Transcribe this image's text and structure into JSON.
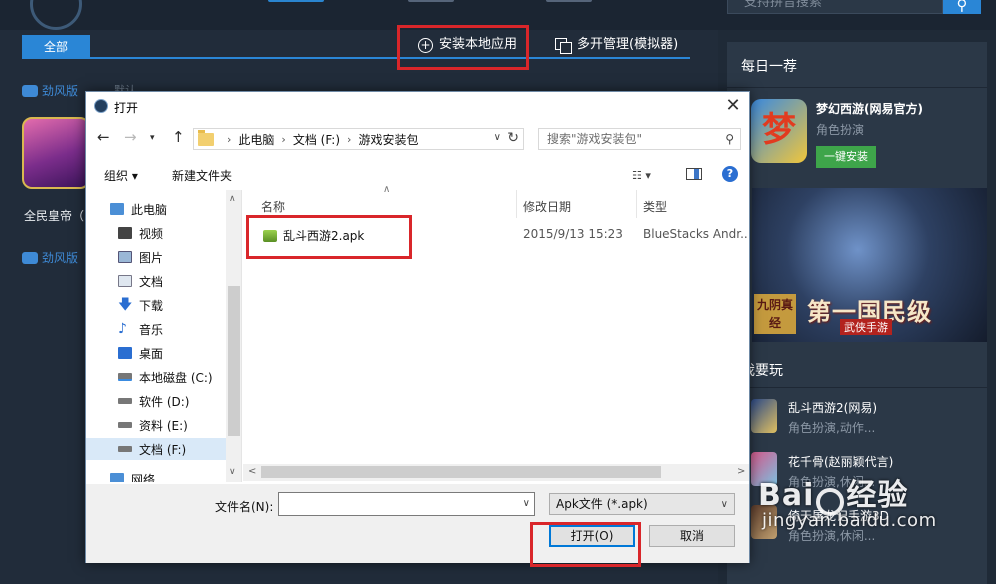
{
  "background": {
    "search_placeholder": "支持拼音搜索",
    "tab_all": "全部",
    "install_local": "安装本地应用",
    "multi_manage": "多开管理(模拟器)",
    "brand_tag_1": "劲风版",
    "moren": "默认",
    "game_name": "全民皇帝（",
    "brand_tag_2": "劲风版"
  },
  "right_panel": {
    "daily_title": "每日一荐",
    "rec_name": "梦幻西游(网易官方)",
    "rec_category": "角色扮演",
    "install_button": "一键安装",
    "banner_title": "第一国民级",
    "banner_sub": "武侠手游",
    "banner_logo": "九阴真经",
    "play_title": "我要玩",
    "play_items": [
      {
        "name": "乱斗西游2(网易)",
        "category": "角色扮演,动作..."
      },
      {
        "name": "花千骨(赵丽颖代言)",
        "category": "角色扮演,休闲..."
      },
      {
        "name": "倚天屠龙记手游3D",
        "category": "角色扮演,休闲..."
      }
    ]
  },
  "watermark": {
    "main_left": "Bai",
    "main_right": "经验",
    "url": "jingyan.baidu.com"
  },
  "dialog": {
    "title": "打开",
    "close": "✕",
    "breadcrumb": [
      "此电脑",
      "文档 (F:)",
      "游戏安装包"
    ],
    "search_placeholder": "搜索\"游戏安装包\"",
    "toolbar": {
      "organize": "组织 ▾",
      "new_folder": "新建文件夹"
    },
    "nav_items": [
      {
        "label": "此电脑"
      },
      {
        "label": "视频"
      },
      {
        "label": "图片"
      },
      {
        "label": "文档"
      },
      {
        "label": "下载"
      },
      {
        "label": "音乐"
      },
      {
        "label": "桌面"
      },
      {
        "label": "本地磁盘 (C:)"
      },
      {
        "label": "软件 (D:)"
      },
      {
        "label": "资料 (E:)"
      },
      {
        "label": "文档 (F:)"
      },
      {
        "label": "网络"
      }
    ],
    "columns": {
      "name": "名称",
      "modified": "修改日期",
      "type": "类型"
    },
    "files": [
      {
        "name": "乱斗西游2.apk",
        "modified": "2015/9/13 15:23",
        "type": "BlueStacks Andr..."
      }
    ],
    "filename_label": "文件名(N):",
    "filename_value": "",
    "file_type": "Apk文件 (*.apk)",
    "open_button": "打开(O)",
    "cancel_button": "取消"
  },
  "colors": {
    "accent": "#2a86d6",
    "highlight_red": "#d9262a",
    "install_green": "#3ea54a",
    "selection": "#d9e9f8"
  }
}
